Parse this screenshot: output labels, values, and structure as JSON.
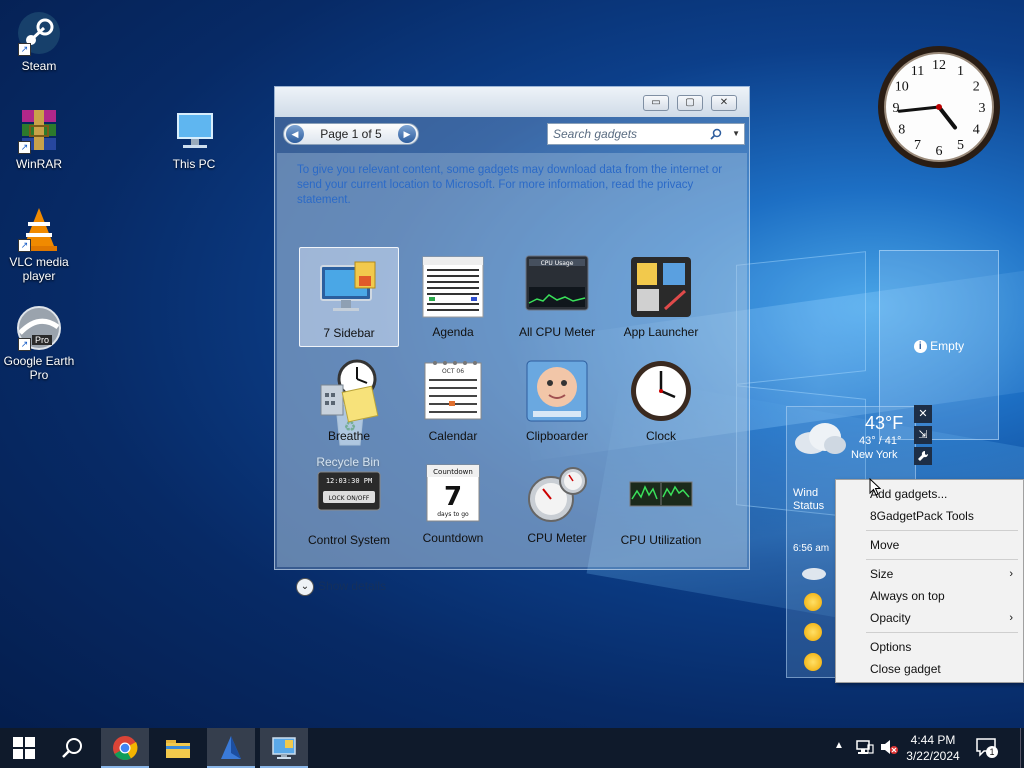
{
  "desktop": {
    "icons": [
      {
        "label": "Steam",
        "icon": "steam-icon"
      },
      {
        "label": "WinRAR",
        "icon": "winrar-icon"
      },
      {
        "label": "This PC",
        "icon": "this-pc-icon"
      },
      {
        "label": "VLC media player",
        "icon": "vlc-icon"
      },
      {
        "label": "Google Earth Pro",
        "icon": "google-earth-icon",
        "badge": "Pro"
      },
      {
        "label": "Recycle Bin",
        "icon": "recycle-bin-icon"
      }
    ]
  },
  "gallery": {
    "window_buttons": {
      "minimize": "▭",
      "maximize": "▢",
      "close": "✕"
    },
    "pager": {
      "label": "Page 1 of 5",
      "prev": "◀",
      "next": "▶"
    },
    "search": {
      "placeholder": "Search gadgets",
      "icon": "search-icon",
      "dropdown": "▼"
    },
    "notice": "To give you relevant content, some gadgets may download data from the internet or send your current location to Microsoft. For more information, read the privacy statement.",
    "gadgets": [
      {
        "label": "7 Sidebar",
        "icon": "monitor-icon"
      },
      {
        "label": "Agenda",
        "icon": "agenda-calendar-icon"
      },
      {
        "label": "All CPU Meter",
        "icon": "cpu-usage-meter-icon",
        "thumb_text": "CPU Usage"
      },
      {
        "label": "App Launcher",
        "icon": "app-launcher-icon"
      },
      {
        "label": "Breathe",
        "icon": "breathe-clock-icon"
      },
      {
        "label": "Calendar",
        "icon": "calendar-icon",
        "thumb_text": "OCT 06"
      },
      {
        "label": "Clipboarder",
        "icon": "clipboarder-icon"
      },
      {
        "label": "Clock",
        "icon": "clock-icon"
      },
      {
        "label": "Control System",
        "icon": "control-system-icon",
        "thumb_text": "12:03:30 PM",
        "thumb_sub": "LOCK ON/OFF"
      },
      {
        "label": "Countdown",
        "icon": "countdown-icon",
        "thumb_text": "Countdown",
        "thumb_number": "7",
        "thumb_sub": "days to go"
      },
      {
        "label": "CPU Meter",
        "icon": "cpu-meter-gauge-icon"
      },
      {
        "label": "CPU Utilization",
        "icon": "cpu-utilization-graph-icon"
      }
    ],
    "show_details": "Show details"
  },
  "clock_gadget": {
    "numerals": [
      "12",
      "1",
      "2",
      "3",
      "4",
      "5",
      "6",
      "7",
      "8",
      "9",
      "10",
      "11"
    ],
    "time": {
      "hour": 4,
      "minute": 44
    }
  },
  "empty_gadget": {
    "label": "Empty",
    "icon": "info-icon"
  },
  "weather": {
    "temp": "43°F",
    "range": "43° / 41°",
    "city": "New York",
    "wind_label": "Wind",
    "status_label": "Status",
    "time": "6:56 am",
    "icon": "cloud-icon"
  },
  "gadget_tools": {
    "close": "✕",
    "resize": "⇲",
    "settings": "wrench-icon",
    "drag": "drag-handle-icon"
  },
  "context_menu": {
    "items": [
      {
        "label": "Add gadgets...",
        "submenu": false
      },
      {
        "label": "8GadgetPack Tools",
        "submenu": false
      },
      {
        "label": "Move",
        "submenu": false
      },
      {
        "label": "Size",
        "submenu": true
      },
      {
        "label": "Always on top",
        "submenu": false
      },
      {
        "label": "Opacity",
        "submenu": true
      },
      {
        "label": "Options",
        "submenu": false
      },
      {
        "label": "Close gadget",
        "submenu": false
      }
    ],
    "submenu_arrow": "›"
  },
  "taskbar": {
    "time": "4:44 PM",
    "date": "3/22/2024",
    "notification_count": "1",
    "tray_icons": [
      "chevron-up-icon",
      "network-icon",
      "volume-muted-icon"
    ]
  }
}
